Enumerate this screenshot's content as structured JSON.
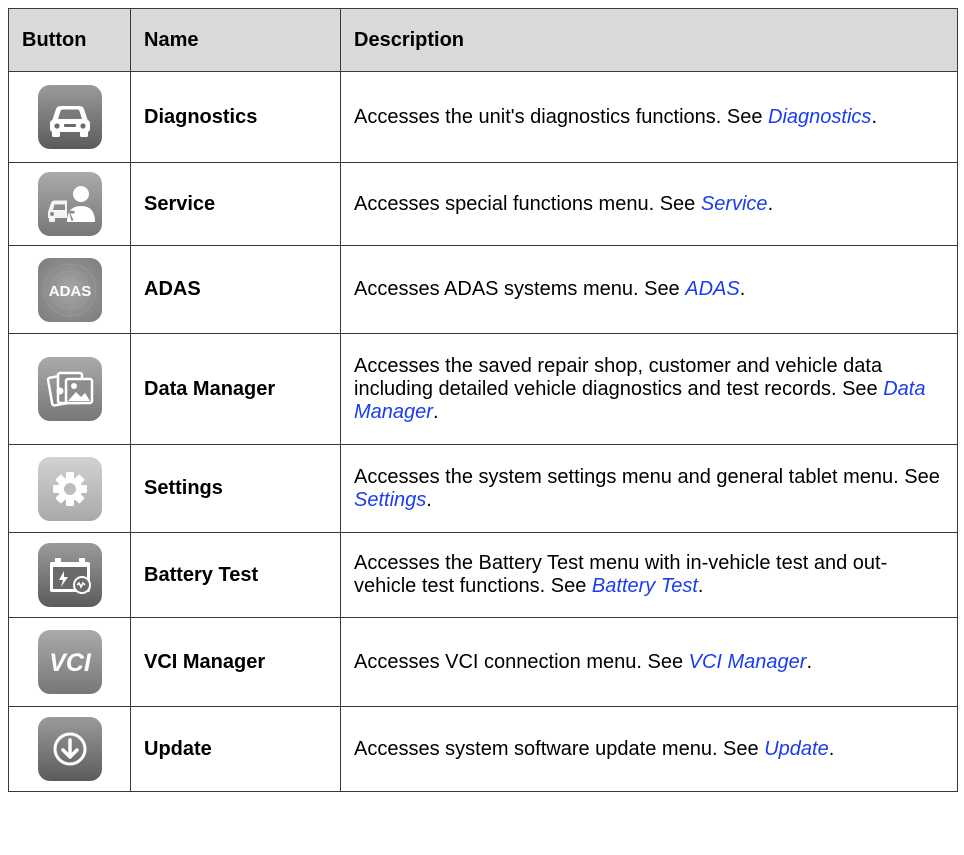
{
  "table": {
    "headers": {
      "button": "Button",
      "name": "Name",
      "description": "Description"
    },
    "rows": [
      {
        "icon": "car-icon",
        "name": "Diagnostics",
        "desc_before": "Accesses the unit's diagnostics functions. See ",
        "link": "Diagnostics",
        "desc_after": "."
      },
      {
        "icon": "service-technician-icon",
        "name": "Service",
        "desc_before": "Accesses special functions menu. See ",
        "link": "Service",
        "desc_after": "."
      },
      {
        "icon": "adas-icon",
        "icon_text": "ADAS",
        "name": "ADAS",
        "desc_before": "Accesses ADAS systems menu. See ",
        "link": "ADAS",
        "desc_after": "."
      },
      {
        "icon": "photo-folder-icon",
        "name": "Data Manager",
        "desc_before": "Accesses the saved repair shop, customer and vehicle data including detailed vehicle diagnostics and test records. See ",
        "link": "Data Manager",
        "desc_after": "."
      },
      {
        "icon": "gear-icon",
        "name": "Settings",
        "desc_before": "Accesses the system settings menu and general tablet menu. See ",
        "link": "Settings",
        "desc_after": "."
      },
      {
        "icon": "battery-icon",
        "name": "Battery Test",
        "desc_before": "Accesses the Battery Test menu with in-vehicle test and out-vehicle test functions. See ",
        "link": "Battery Test",
        "desc_after": "."
      },
      {
        "icon": "vci-icon",
        "icon_text": "VCI",
        "name": "VCI Manager",
        "desc_before": "Accesses VCI connection menu. See ",
        "link": "VCI Manager",
        "desc_after": "."
      },
      {
        "icon": "download-arrow-icon",
        "name": "Update",
        "desc_before": "Accesses system software update menu. See ",
        "link": "Update",
        "desc_after": "."
      }
    ]
  }
}
